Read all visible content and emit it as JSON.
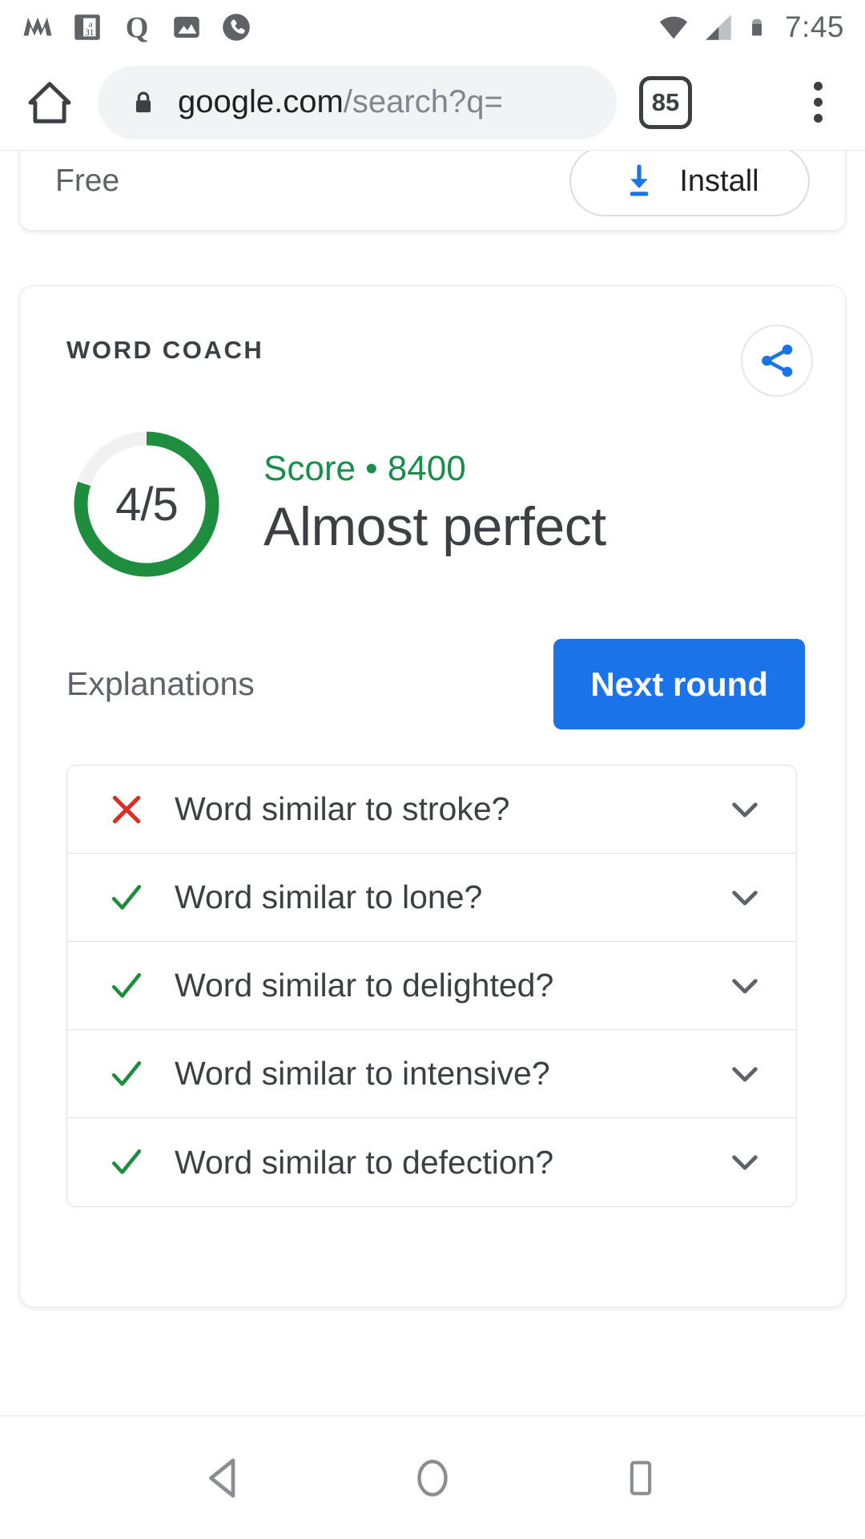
{
  "status_bar": {
    "icons": [
      "monzo-m-icon",
      "calendar-day-icon",
      "quora-q-icon",
      "gallery-image-icon",
      "phone-call-icon"
    ],
    "wifi_icon": "wifi-icon",
    "signal_icon": "cellular-signal-icon",
    "battery_icon": "battery-icon",
    "clock": "7:45"
  },
  "toolbar": {
    "home_icon": "home-icon",
    "lock_icon": "lock-icon",
    "url_domain": "google.com",
    "url_path": "/search?q=",
    "tab_count": "85",
    "menu_icon": "overflow-menu-icon"
  },
  "install_card": {
    "price_label": "Free",
    "install_label": "Install",
    "download_icon": "download-icon"
  },
  "word_coach": {
    "title": "WORD COACH",
    "share_icon": "share-icon",
    "ring": {
      "value_label": "4/5",
      "correct": 4,
      "total": 5,
      "percent": 80,
      "track_color": "#f1f1f1",
      "progress_color": "#1e8e3e"
    },
    "score_line": "Score • 8400",
    "score_value": 8400,
    "headline": "Almost perfect",
    "explanations_label": "Explanations",
    "next_round_label": "Next round",
    "next_round_color": "#1a73e8",
    "items": [
      {
        "text": "Word similar to stroke?",
        "status": "incorrect",
        "mark_icon": "close-icon",
        "chevron_icon": "chevron-down-icon"
      },
      {
        "text": "Word similar to lone?",
        "status": "correct",
        "mark_icon": "check-icon",
        "chevron_icon": "chevron-down-icon"
      },
      {
        "text": "Word similar to delighted?",
        "status": "correct",
        "mark_icon": "check-icon",
        "chevron_icon": "chevron-down-icon"
      },
      {
        "text": "Word similar to intensive?",
        "status": "correct",
        "mark_icon": "check-icon",
        "chevron_icon": "chevron-down-icon"
      },
      {
        "text": "Word similar to defection?",
        "status": "correct",
        "mark_icon": "check-icon",
        "chevron_icon": "chevron-down-icon"
      }
    ],
    "colors": {
      "correct": "#1e8e3e",
      "incorrect": "#d93025",
      "chevron": "#5f6368"
    }
  },
  "nav_bar": {
    "back_icon": "back-triangle-icon",
    "home_icon": "home-circle-icon",
    "recents_icon": "recents-square-icon"
  }
}
